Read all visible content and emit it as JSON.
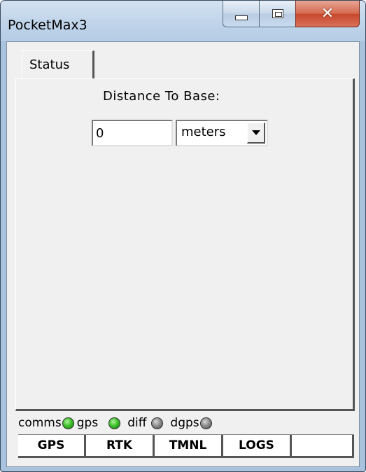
{
  "window": {
    "title": "PocketMax3"
  },
  "tabs": [
    {
      "label": "Status",
      "selected": true
    }
  ],
  "status_panel": {
    "distance_label": "Distance To Base:",
    "distance_value": "0",
    "units_selected": "meters"
  },
  "indicators": [
    {
      "label": "comms",
      "state": "green"
    },
    {
      "label": "gps",
      "state": "green"
    },
    {
      "label": "diff",
      "state": "gray"
    },
    {
      "label": "dgps",
      "state": "gray"
    }
  ],
  "bottom_tabs": [
    {
      "label": "GPS"
    },
    {
      "label": "RTK"
    },
    {
      "label": "TMNL"
    },
    {
      "label": "LOGS"
    },
    {
      "label": ""
    }
  ],
  "colors": {
    "led_green": "#3cc22a",
    "led_gray": "#8e8e8e",
    "close_button": "#c7472a",
    "panel_background": "#f0f0f0"
  }
}
